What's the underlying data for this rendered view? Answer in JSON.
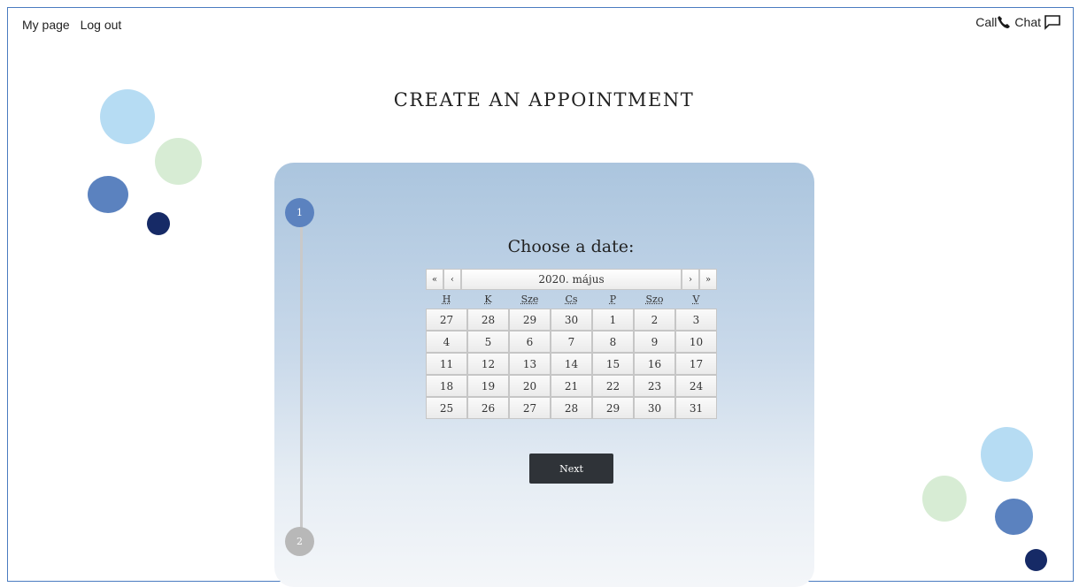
{
  "topbar": {
    "my_page": "My page",
    "logout": "Log out",
    "call": "Call",
    "chat": "Chat"
  },
  "page": {
    "title": "CREATE AN APPOINTMENT"
  },
  "steps": {
    "step1": "1",
    "step2": "2"
  },
  "calendar": {
    "heading": "Choose a date:",
    "month": "2020. május",
    "prev_year": "«",
    "prev_month": "‹",
    "next_month": "›",
    "next_year": "»",
    "weekdays": [
      "H",
      "K",
      "Sze",
      "Cs",
      "P",
      "Szo",
      "V"
    ],
    "weeks": [
      [
        "27",
        "28",
        "29",
        "30",
        "1",
        "2",
        "3"
      ],
      [
        "4",
        "5",
        "6",
        "7",
        "8",
        "9",
        "10"
      ],
      [
        "11",
        "12",
        "13",
        "14",
        "15",
        "16",
        "17"
      ],
      [
        "18",
        "19",
        "20",
        "21",
        "22",
        "23",
        "24"
      ],
      [
        "25",
        "26",
        "27",
        "28",
        "29",
        "30",
        "31"
      ]
    ]
  },
  "actions": {
    "next": "Next"
  },
  "colors": {
    "light_blue": "#b6dcf3",
    "light_green": "#d7ecd4",
    "mid_blue": "#5b82bf",
    "navy": "#162a66"
  }
}
